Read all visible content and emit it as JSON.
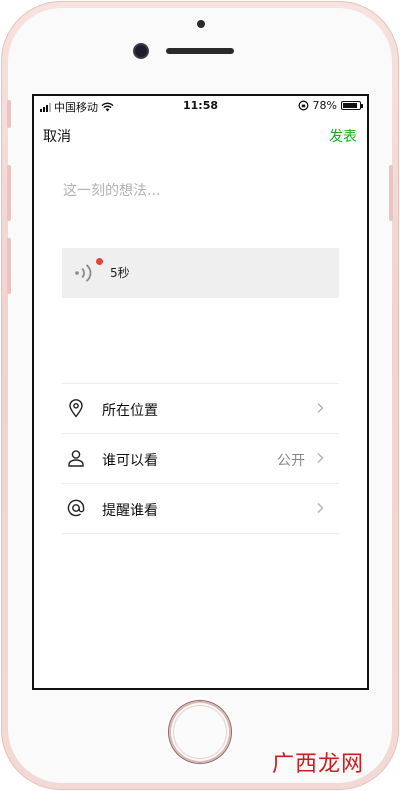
{
  "status_bar": {
    "carrier": "中国移动",
    "time": "11:58",
    "battery_percent": "78%"
  },
  "nav": {
    "cancel_label": "取消",
    "publish_label": "发表"
  },
  "composer": {
    "placeholder": "这一刻的想法..."
  },
  "voice_message": {
    "duration": "5秒"
  },
  "options": {
    "location": {
      "label": "所在位置",
      "value": ""
    },
    "visibility": {
      "label": "谁可以看",
      "value": "公开"
    },
    "mention": {
      "label": "提醒谁看",
      "value": ""
    }
  },
  "watermark": {
    "text": "广西龙网"
  },
  "colors": {
    "accent_green": "#1aad19",
    "unread_dot": "#e8403b",
    "watermark_red": "#c81e1e",
    "phone_rose_gold": "#f1d3cf"
  }
}
